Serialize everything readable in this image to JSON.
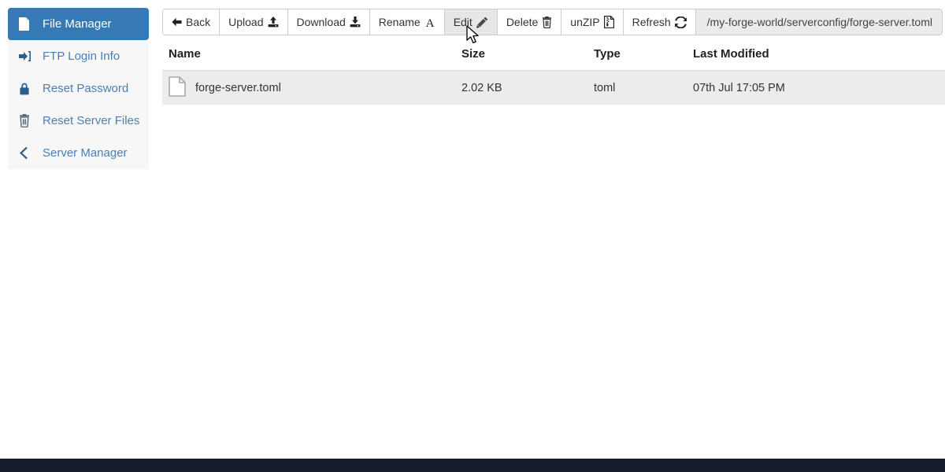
{
  "sidebar": {
    "items": [
      {
        "label": "File Manager",
        "icon": "file-icon",
        "active": true
      },
      {
        "label": "FTP Login Info",
        "icon": "sign-in-icon",
        "active": false
      },
      {
        "label": "Reset Password",
        "icon": "lock-icon",
        "active": false
      },
      {
        "label": "Reset Server Files",
        "icon": "trash-icon",
        "active": false
      },
      {
        "label": "Server Manager",
        "icon": "chevron-left-icon",
        "active": false
      }
    ]
  },
  "toolbar": {
    "buttons": [
      {
        "label": "Back",
        "icon": "arrow-left-icon",
        "icon_side": "left",
        "hover": false
      },
      {
        "label": "Upload",
        "icon": "upload-icon",
        "icon_side": "right",
        "hover": false
      },
      {
        "label": "Download",
        "icon": "download-icon",
        "icon_side": "right",
        "hover": false
      },
      {
        "label": "Rename",
        "icon": "text-a-icon",
        "icon_side": "right",
        "hover": false
      },
      {
        "label": "Edit",
        "icon": "pencil-icon",
        "icon_side": "right",
        "hover": true
      },
      {
        "label": "Delete",
        "icon": "trash-icon",
        "icon_side": "right",
        "hover": false
      },
      {
        "label": "unZIP",
        "icon": "file-archive-icon",
        "icon_side": "right",
        "hover": false
      },
      {
        "label": "Refresh",
        "icon": "refresh-icon",
        "icon_side": "right",
        "hover": false
      }
    ],
    "path": "/my-forge-world/serverconfig/forge-server.toml"
  },
  "file_table": {
    "columns": [
      "Name",
      "Size",
      "Type",
      "Last Modified",
      ""
    ],
    "rows": [
      {
        "name": "forge-server.toml",
        "size": "2.02 KB",
        "type": "toml",
        "last_modified": "07th Jul 17:05 PM",
        "selected": true,
        "icon": "file-outline-icon"
      }
    ]
  },
  "colors": {
    "accent_blue": "#3579b5",
    "link_blue": "#4a7fb5",
    "row_grey": "#ececec",
    "hover_grey": "#e6e6e6",
    "path_grey": "#ebebeb",
    "bottom_bar": "#141d29"
  }
}
